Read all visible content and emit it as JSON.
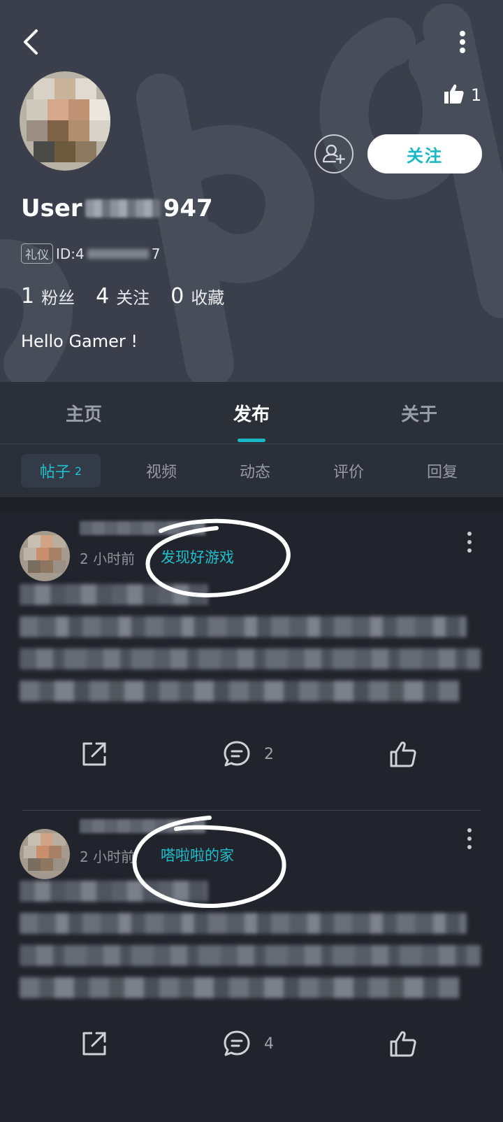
{
  "header": {
    "like_count": "1",
    "follow_label": "关注",
    "username_prefix": "User",
    "username_suffix": "947",
    "badge": "礼仪",
    "id_prefix": "ID:4",
    "id_suffix": "7",
    "stats": [
      {
        "num": "1",
        "label": "粉丝"
      },
      {
        "num": "4",
        "label": "关注"
      },
      {
        "num": "0",
        "label": "收藏"
      }
    ],
    "bio": "Hello Gamer !"
  },
  "tabs": [
    "主页",
    "发布",
    "关于"
  ],
  "active_tab": "发布",
  "subtabs": {
    "active_label": "帖子",
    "active_count": "2",
    "items": [
      "视频",
      "动态",
      "评价",
      "回复"
    ]
  },
  "posts": [
    {
      "time": "2 小时前",
      "group": "发现好游戏",
      "comment_count": "2"
    },
    {
      "time": "2 小时前",
      "group": "嗒啦啦的家",
      "comment_count": "4"
    }
  ],
  "colors": {
    "accent": "#18b9c5",
    "header_bg": "#3a3f4b",
    "page_bg": "#21242c"
  },
  "icons": [
    "back-arrow-icon",
    "more-vertical-icon",
    "thumbs-up-icon",
    "add-user-icon",
    "share-icon",
    "comment-icon"
  ]
}
